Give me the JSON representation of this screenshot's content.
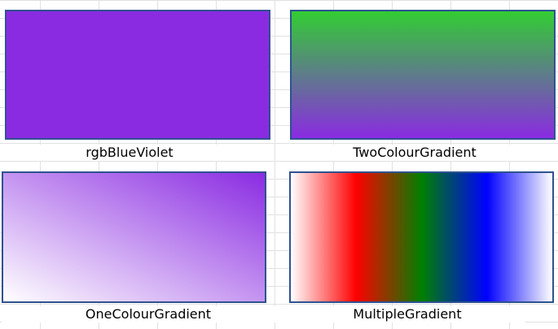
{
  "shapes": [
    {
      "label": "rgbBlueViolet",
      "fill": "solid",
      "colors": [
        "#8a2be2"
      ]
    },
    {
      "label": "TwoColourGradient",
      "fill": "linear-vertical",
      "colors": [
        "#32cd32",
        "#8a2be2"
      ]
    },
    {
      "label": "OneColourGradient",
      "fill": "linear-diagonal",
      "colors": [
        "#8a2be2",
        "#ffffff"
      ]
    },
    {
      "label": "MultipleGradient",
      "fill": "linear-horizontal",
      "colors": [
        "#ffffff",
        "#ff0000",
        "#008000",
        "#0000ff",
        "#ffffff"
      ]
    }
  ],
  "shape_border_color": "#2f528f"
}
